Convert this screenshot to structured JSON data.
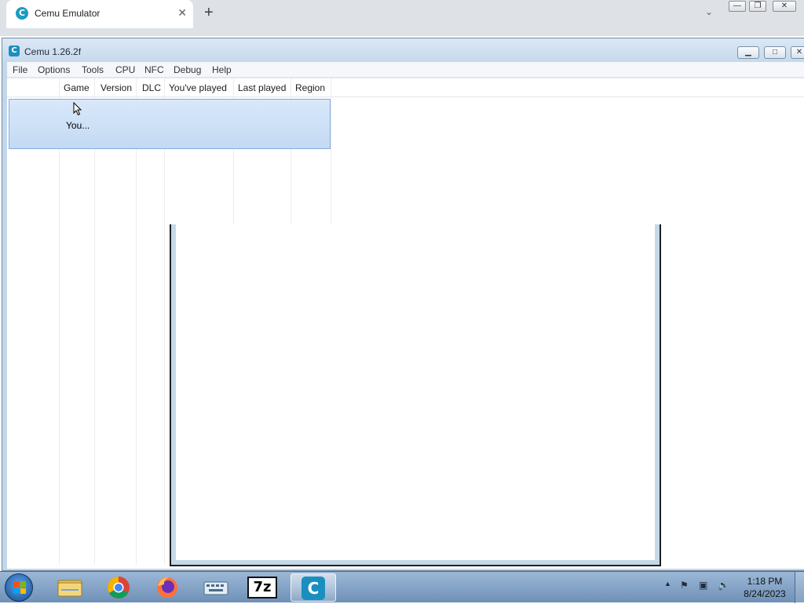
{
  "browser": {
    "tab_title": "Cemu Emulator",
    "tab_icon": "C",
    "close_glyph": "✕",
    "new_tab_glyph": "+",
    "chevron_glyph": "⌄"
  },
  "window": {
    "title": "Cemu 1.26.2f",
    "icon": "C"
  },
  "menu": [
    "File",
    "Options",
    "Tools",
    "CPU",
    "NFC",
    "Debug",
    "Help"
  ],
  "columns": [
    "Game",
    "Version",
    "DLC",
    "You've played",
    "Last played",
    "Region"
  ],
  "rows": [
    {
      "text": "You..."
    }
  ],
  "taskbar": {
    "apps": [
      "file-explorer",
      "chrome",
      "firefox",
      "keyboard",
      "7zip",
      "cemu"
    ],
    "seven_zip_label": "7z",
    "cemu_label": "C"
  },
  "clock": {
    "time": "1:18 PM",
    "date": "8/24/2023"
  },
  "colors": {
    "selection": "#c3daf4",
    "taskbar": "#7f9fc4",
    "cemu_accent": "#1a8fbf"
  }
}
